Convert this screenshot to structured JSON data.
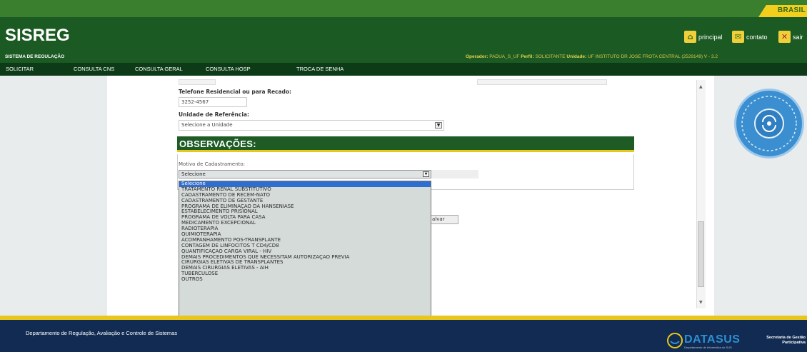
{
  "brasil": "BRASIL",
  "logo": {
    "title": "SISREG",
    "subtitle": "SISTEMA DE REGULAÇÃO"
  },
  "toplinks": [
    {
      "label": "principal",
      "icon": "home-icon"
    },
    {
      "label": "contato",
      "icon": "mail-icon"
    },
    {
      "label": "sair",
      "icon": "close-icon"
    }
  ],
  "operator_line": {
    "operador_label": "Operador:",
    "operador": "PADUA_S_UF",
    "perfil_label": "Perfil:",
    "perfil": "SOLICITANTE",
    "unidade_label": "Unidade:",
    "unidade": "UF INSTITUTO DR JOSE FROTA CENTRAL (2529149) V - 3.2"
  },
  "menu": [
    "SOLICITAR",
    "CONSULTA CNS",
    "CONSULTA GERAL",
    "CONSULTA HOSP",
    "TROCA DE SENHA"
  ],
  "form": {
    "telefone_label": "Telefone Residencial ou para Recado:",
    "telefone_value": "3252-4567",
    "unidade_label": "Unidade de Referência:",
    "unidade_value": "Selecione a Unidade"
  },
  "observacoes": {
    "title": "OBSERVAÇÕES:",
    "motivo_label": "Motivo de Cadastramento:",
    "motivo_selected": "Selecione",
    "options": [
      "Selecione",
      "TRATAMENTO RENAL SUBSTITUTIVO",
      "CADASTRAMENTO DE RECEM-NATO",
      "CADASTRAMENTO DE GESTANTE",
      "PROGRAMA DE ELIMINAÇÃO DA HANSENÍASE",
      "ESTABELECIMENTO PRISIONAL",
      "PROGRAMA DE VOLTA PARA CASA",
      "MEDICAMENTO EXCEPCIONAL",
      "RADIOTERAPIA",
      "QUIMIOTERAPIA",
      "ACOMPANHAMENTO PÓS-TRANSPLANTE",
      "CONTAGEM DE LINFÓCITOS T CD4/CD8",
      "QUANTIFICAÇÃO CARGA VIRAL - HIV",
      "DEMAIS PROCEDIMENTOS QUE NECESSITAM AUTORIZAÇÃO PRÉVIA",
      "CIRURGIAS ELETIVAS DE TRANSPLANTES",
      "DEMAIS CIRURGIAS ELETIVAS - AIH",
      "TUBERCULOSE",
      "OUTROS"
    ]
  },
  "salvar_label": "alvar",
  "footer": {
    "text": "Departamento de Regulação, Avaliação e Controle de Sistemas",
    "brand": "DATASUS",
    "brand_sub": "Departamento de Informática do SUS",
    "secretaria": "Secretaria de Gestão Participativa"
  },
  "colors": {
    "header_green": "#1c5a23",
    "menu_dark": "#0d3a17",
    "accent_yellow": "#e7c81d",
    "footer_blue": "#112b52",
    "selected_blue": "#2f6ecf"
  }
}
